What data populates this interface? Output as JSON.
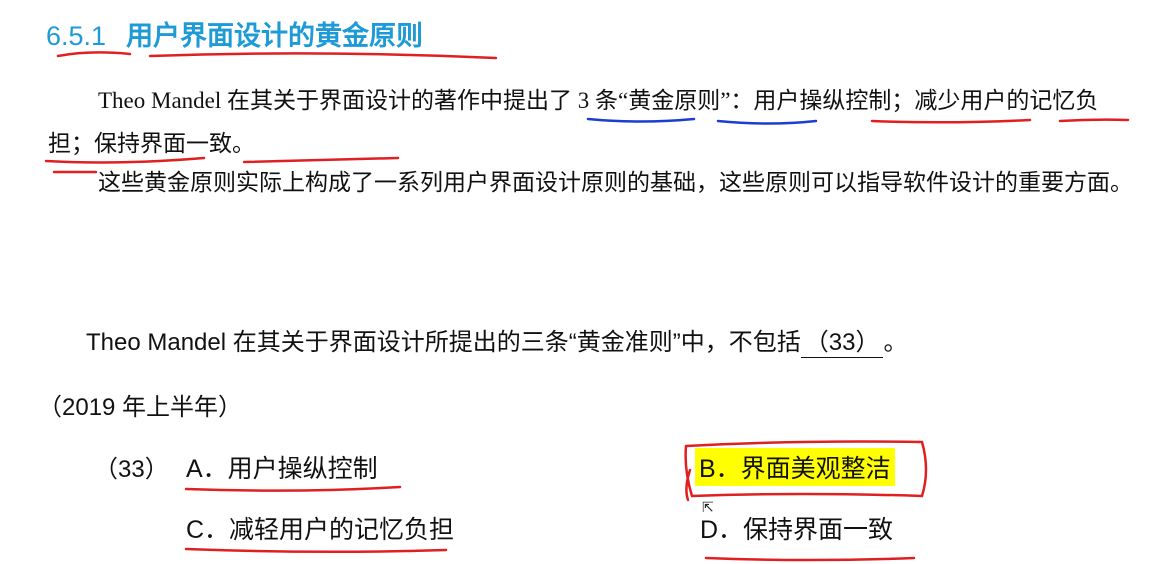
{
  "heading": {
    "number": "6.5.1",
    "title": "用户界面设计的黄金原则"
  },
  "paragraph1": {
    "lead": "Theo Mandel 在其关于界面设计的著作中提出了 3 条“黄金原则”：用户操纵控制；减少用户的记忆负担；保持界面一致。"
  },
  "paragraph2": {
    "text": "这些黄金原则实际上构成了一系列用户界面设计原则的基础，这些原则可以指导软件设计的重要方面。"
  },
  "question": {
    "stem": "Theo  Mandel 在其关于界面设计所提出的三条“黄金准则”中，不包括",
    "blank": "（33）",
    "end": "。",
    "year": "（2019 年上半年）",
    "number": "（33）",
    "options": {
      "a": "A．用户操纵控制",
      "b": "B．界面美观整洁",
      "c": "C．减轻用户的记忆负担",
      "d": "D．保持界面一致"
    }
  },
  "colors": {
    "heading": "#1e9bd7",
    "ink_red": "#e02020",
    "ink_blue": "#1a3fd0",
    "highlight": "#ffff00"
  },
  "cursor_icon": "mouse-pointer-icon"
}
